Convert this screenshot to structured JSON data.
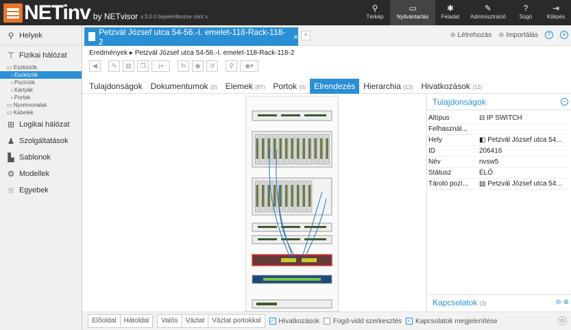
{
  "app": {
    "logo": "NETinv",
    "by": "by NETvisor",
    "version": "v.3.0.0 bejelentkezve mint x"
  },
  "topnav": [
    {
      "label": "Térkép",
      "icon": "map-pin-icon"
    },
    {
      "label": "Nyilvántartás",
      "icon": "inbox-icon"
    },
    {
      "label": "Feladat",
      "icon": "gear-icon"
    },
    {
      "label": "Adminisztráció",
      "icon": "wrench-icon"
    },
    {
      "label": "Súgó",
      "icon": "help-icon"
    },
    {
      "label": "Kilépés",
      "icon": "logout-icon"
    }
  ],
  "sidebar": {
    "helyek": "Helyek",
    "fizikai": "Fizikai hálózat",
    "eszkozok": "Eszközök",
    "eszkozok_sub": "› Eszközök",
    "poziciok": "› Pozíciók",
    "kartyak": "› Kártyák",
    "portok": "› Portok",
    "nyomvonalak": "Nyomvonalak",
    "kabelek": "Kábelek",
    "logikai": "Logikai hálózat",
    "szolgaltatasok": "Szolgáltatások",
    "sablonok": "Sablonok",
    "modellek": "Modellek",
    "egyebek": "Egyebek"
  },
  "tabstrip": {
    "active_tab": "Petzvál József utca 54-56.-I. emelet-118-Rack-118-2",
    "close": "×",
    "add": "+",
    "create": "Létrehozás",
    "import": "Importálás"
  },
  "breadcrumb": {
    "root": "Eredmények",
    "sep": "▸",
    "current": "Petzvál József utca 54-56.-I. emelet-118-Rack-118-2"
  },
  "ctabs": [
    {
      "label": "Tulajdonságok",
      "count": ""
    },
    {
      "label": "Dokumentumok",
      "count": "(0)"
    },
    {
      "label": "Elemek",
      "count": "(87)"
    },
    {
      "label": "Portok",
      "count": "(0)"
    },
    {
      "label": "Elrendezés",
      "count": ""
    },
    {
      "label": "Hierarchia",
      "count": "(13)"
    },
    {
      "label": "Hivatkozások",
      "count": "(12)"
    }
  ],
  "panel": {
    "title": "Tulajdonságok",
    "rows": [
      {
        "k": "Altípus",
        "v": "⊟ IP SWITCH"
      },
      {
        "k": "Felhasznál...",
        "v": ""
      },
      {
        "k": "Hely",
        "v": "Petzvál József utca 54..."
      },
      {
        "k": "ID",
        "v": "206416"
      },
      {
        "k": "Név",
        "v": "nvsw5"
      },
      {
        "k": "Státusz",
        "v": "ÉLŐ"
      },
      {
        "k": "Tároló pozí...",
        "v": "Petzvál József utca 54..."
      }
    ],
    "footer": "Kapcsolatok",
    "footer_count": "(3)"
  },
  "bottombar": {
    "front": "Előoldal",
    "back": "Hátoldal",
    "real": "Valós",
    "sketch": "Vázlat",
    "sketch_ports": "Vázlat portokkal",
    "links": "Hivatkozások",
    "dragdrop": "Fogd-vidd szerkesztés",
    "show_conn": "Kapcsolatok megjelenítése"
  },
  "colors": {
    "accent": "#2a8fd4",
    "logo": "#e8742a",
    "topbar": "#2a2a2a",
    "highlight": "#e53935"
  }
}
